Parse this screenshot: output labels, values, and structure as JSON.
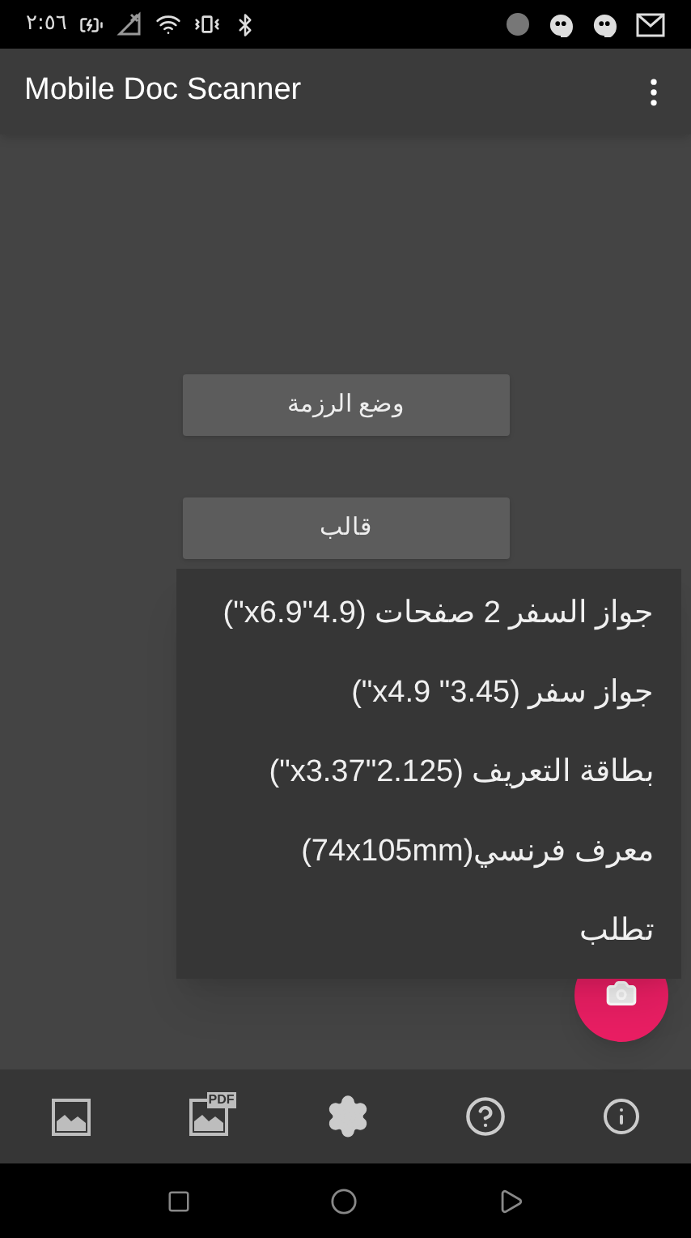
{
  "status_bar": {
    "time": "٢:٥٦"
  },
  "app_bar": {
    "title": "Mobile Doc Scanner"
  },
  "buttons": [
    {
      "label": "وضع الرزمة"
    },
    {
      "label": "قالب"
    }
  ],
  "menu": {
    "items": [
      {
        "label": "جواز السفر 2 صفحات (4.9\"x6.9\")"
      },
      {
        "label": "جواز سفر (3.45\" x4.9\")"
      },
      {
        "label": "بطاقة التعريف (2.125\"x3.37\")"
      },
      {
        "label": "معرف فرنسي(74x105mm)"
      },
      {
        "label": "تطلب"
      }
    ]
  },
  "bottom_bar": {
    "pdf_badge": "PDF"
  }
}
